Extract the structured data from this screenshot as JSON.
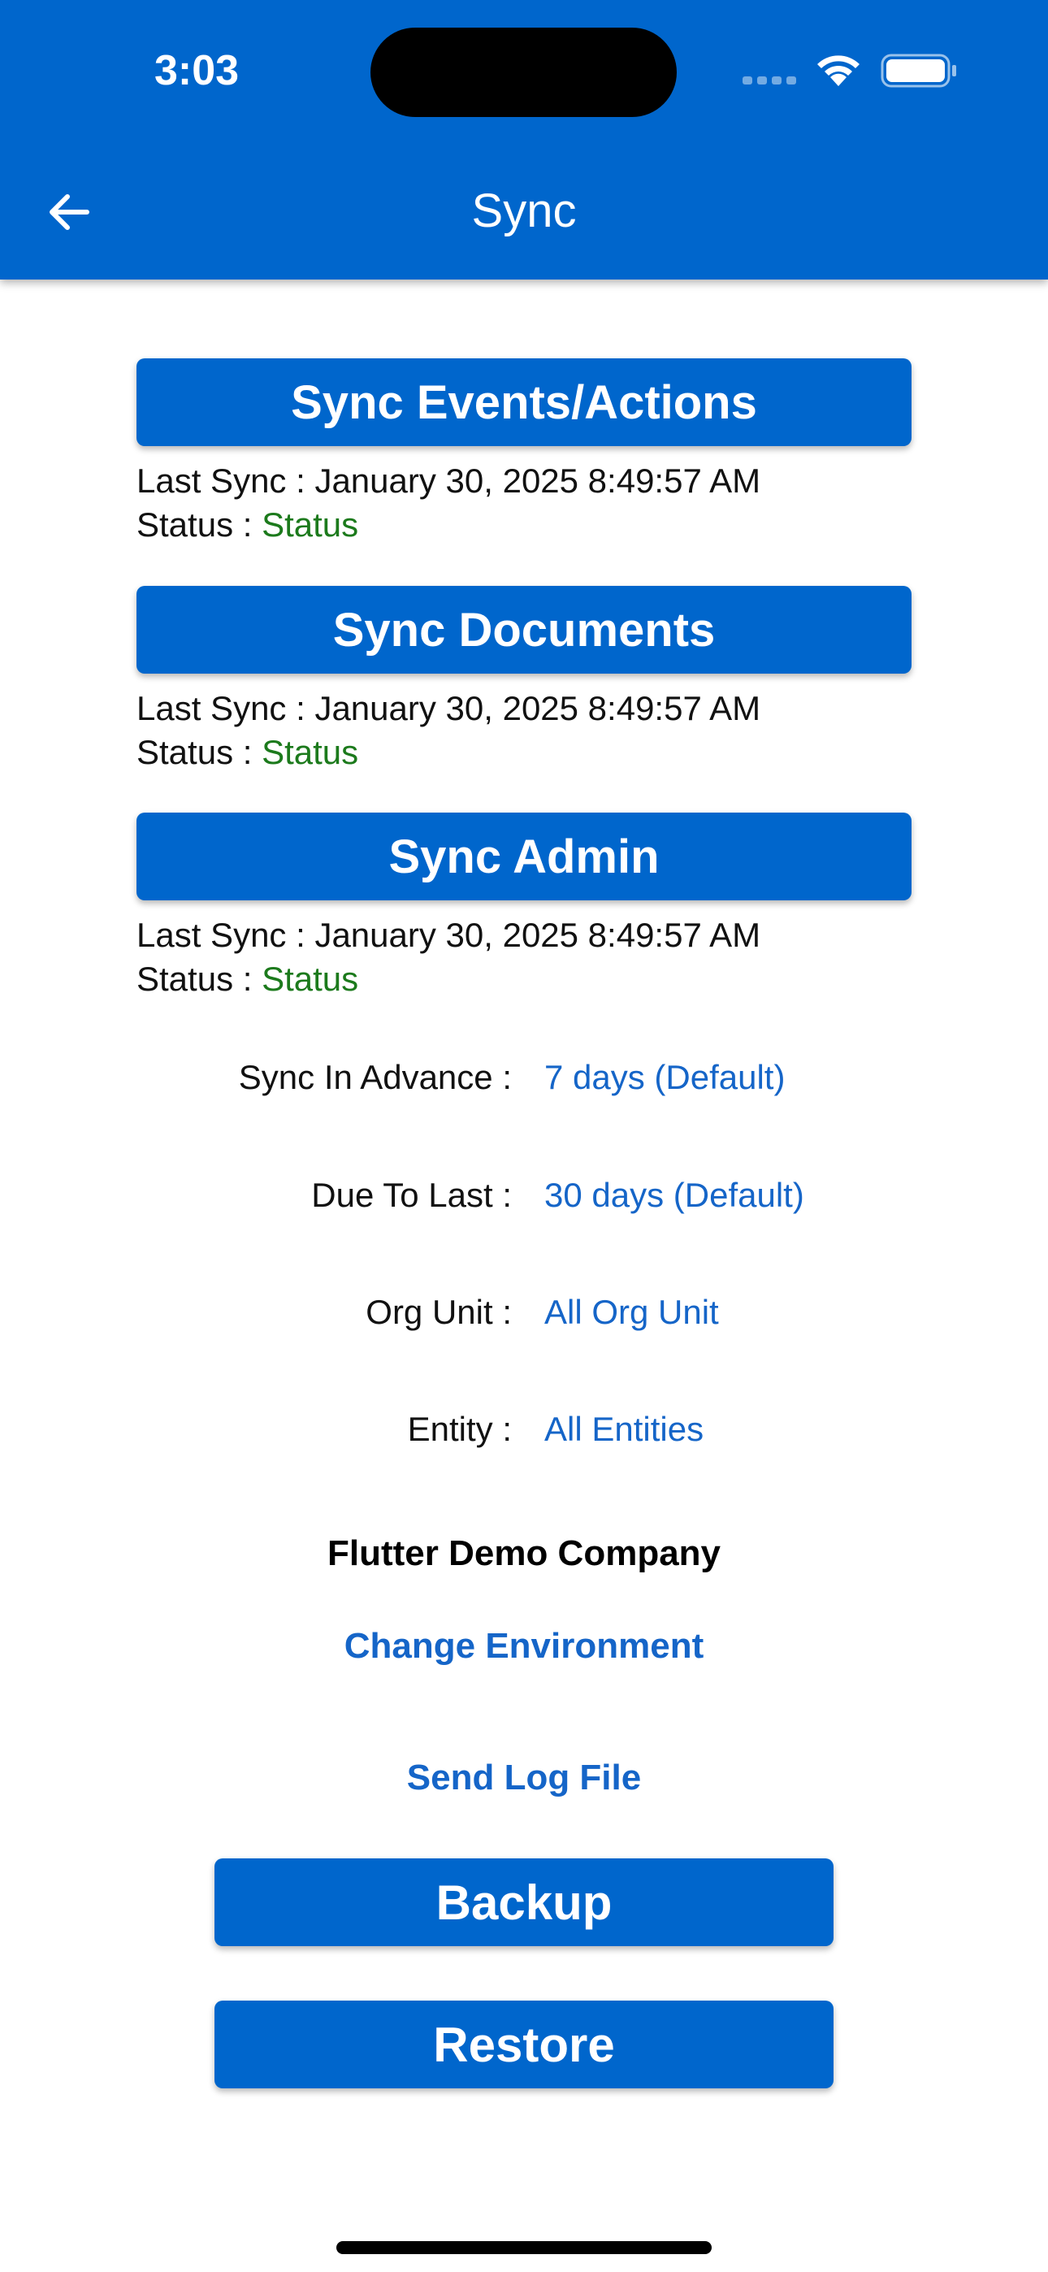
{
  "status_bar": {
    "time": "3:03"
  },
  "header": {
    "title": "Sync",
    "back_icon": "arrow-left-icon"
  },
  "sync_sections": [
    {
      "button_label": "Sync Events/Actions",
      "last_sync_label": "Last Sync : ",
      "last_sync_value": "January 30, 2025 8:49:57 AM",
      "status_label": "Status : ",
      "status_value": "Status"
    },
    {
      "button_label": "Sync Documents",
      "last_sync_label": "Last Sync : ",
      "last_sync_value": "January 30, 2025 8:49:57 AM",
      "status_label": "Status : ",
      "status_value": "Status"
    },
    {
      "button_label": "Sync Admin",
      "last_sync_label": "Last Sync : ",
      "last_sync_value": "January 30, 2025 8:49:57 AM",
      "status_label": "Status : ",
      "status_value": "Status"
    }
  ],
  "settings": [
    {
      "label": "Sync In Advance :",
      "value": "7 days (Default)"
    },
    {
      "label": "Due To Last :",
      "value": "30 days (Default)"
    },
    {
      "label": "Org Unit :",
      "value": "All Org Unit"
    },
    {
      "label": "Entity :",
      "value": "All Entities"
    }
  ],
  "company": {
    "name": "Flutter Demo Company",
    "change_environment_label": "Change Environment"
  },
  "send_log_label": "Send Log File",
  "backup_label": "Backup",
  "restore_label": "Restore",
  "colors": {
    "primary": "#0066CC",
    "link": "#1565C8",
    "status_green": "#1C7A1C"
  }
}
